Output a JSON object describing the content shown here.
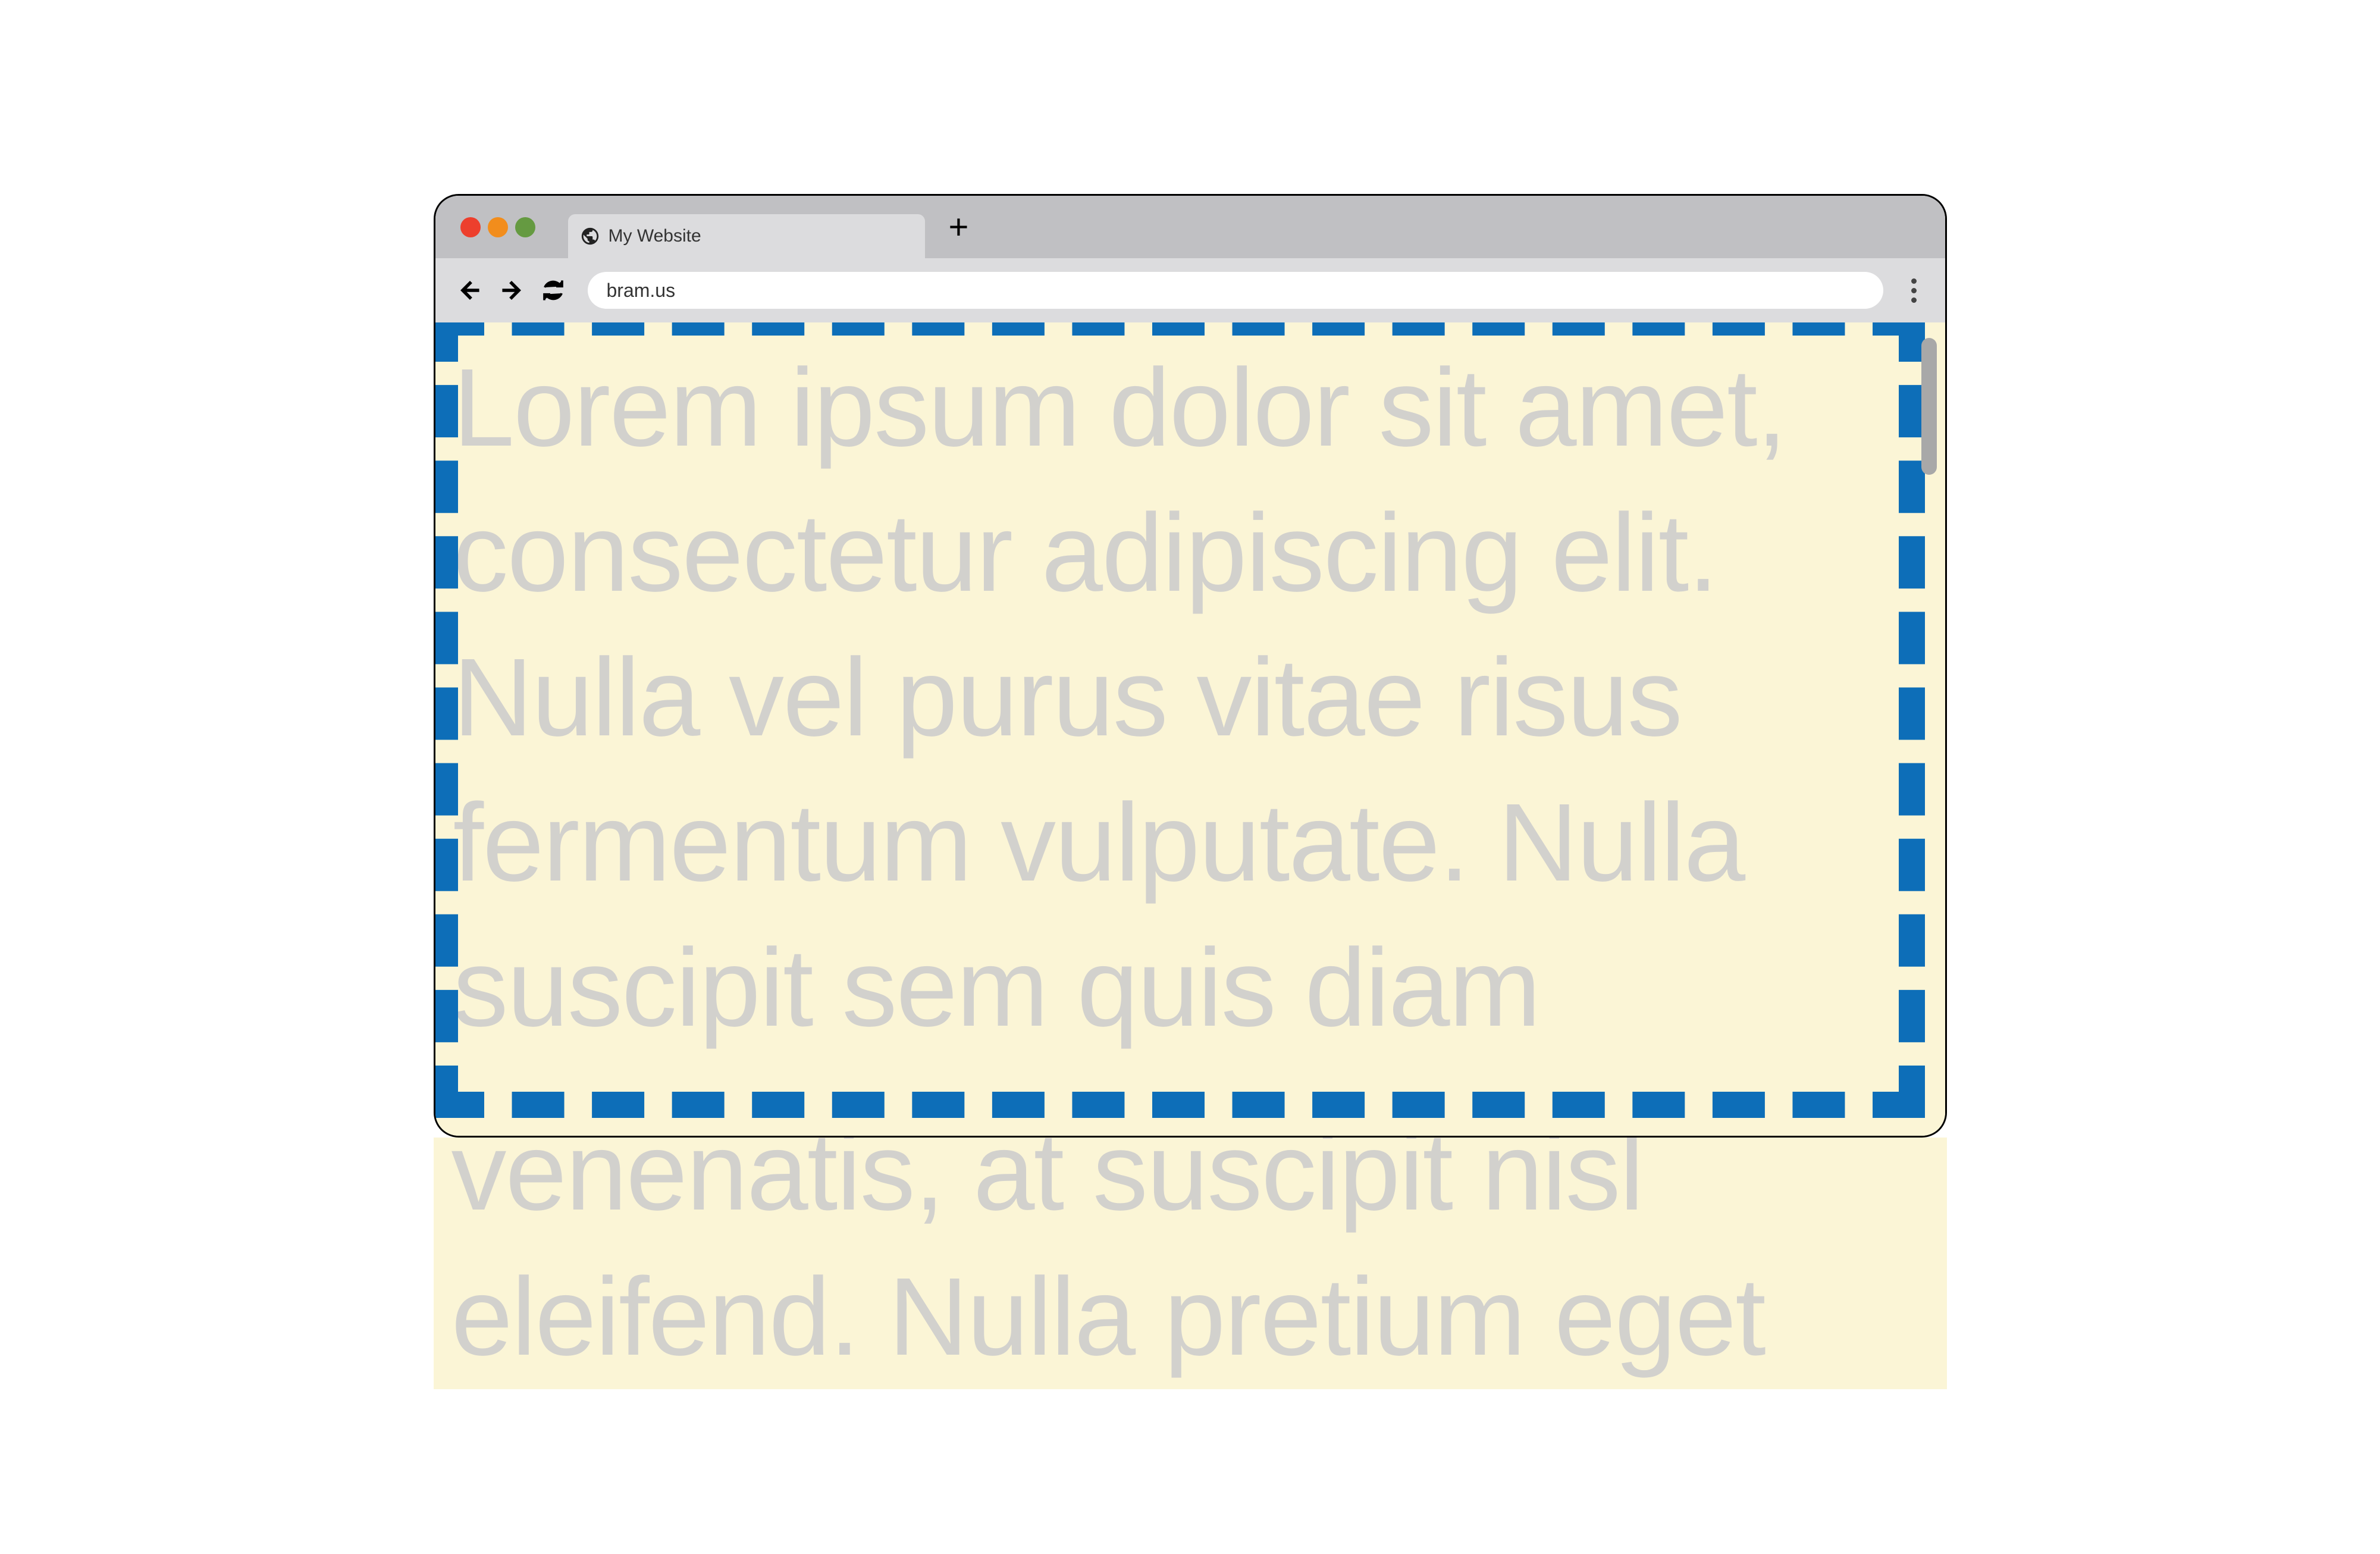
{
  "window": {
    "tab_title": "My Website",
    "url": "bram.us"
  },
  "content": {
    "body_text": "Lorem ipsum dolor sit amet, consectetur adipiscing elit. Nulla vel purus vitae risus fermentum vulputate. Nulla suscipit sem quis diam",
    "overflow_line1": "venenatis, at suscipit nisl",
    "overflow_line2": "eleifend. Nulla pretium eget"
  },
  "colors": {
    "page_bg": "#fbf5d6",
    "text": "#d2d1cd",
    "border_dash": "#0d6eb8",
    "chrome_tabbar": "#c0c0c3",
    "chrome_toolbar": "#dcdcde"
  }
}
